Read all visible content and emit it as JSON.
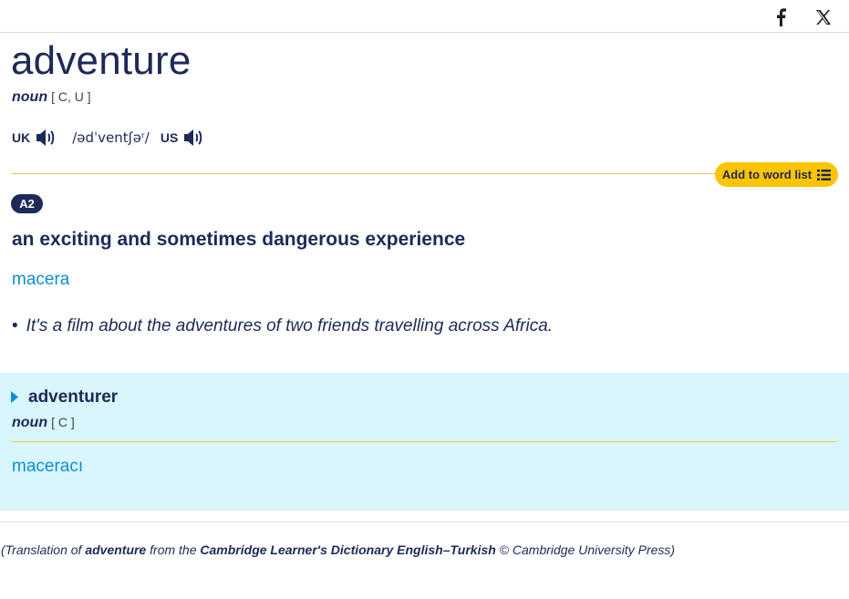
{
  "social": {
    "facebook_icon": "facebook-icon",
    "x_icon": "x-twitter-icon"
  },
  "entry": {
    "headword": "adventure",
    "pos": "noun",
    "grammar": "[ C, U ]",
    "uk_label": "UK",
    "us_label": "US",
    "ipa": "/ədˈventʃəʳ/",
    "word_list_label": "Add to word list",
    "level": "A2",
    "definition": "an exciting and sometimes dangerous experience",
    "translation": "macera",
    "example_bullet": "•",
    "example": "It's a film about the adventures of two friends travelling across Africa."
  },
  "runon": {
    "word": "adventurer",
    "pos": "noun",
    "grammar": "[ C ]",
    "translation": "maceracı"
  },
  "credit": {
    "part1": "(Translation of ",
    "word": "adventure",
    "part2": " from the ",
    "dictionary": "Cambridge Learner's Dictionary English–Turkish",
    "part3": " © Cambridge University Press)"
  },
  "colors": {
    "navy": "#1d2a57",
    "link_blue": "#0d8ed1",
    "gold": "#fec400",
    "runon_bg": "#d8f6fb"
  }
}
